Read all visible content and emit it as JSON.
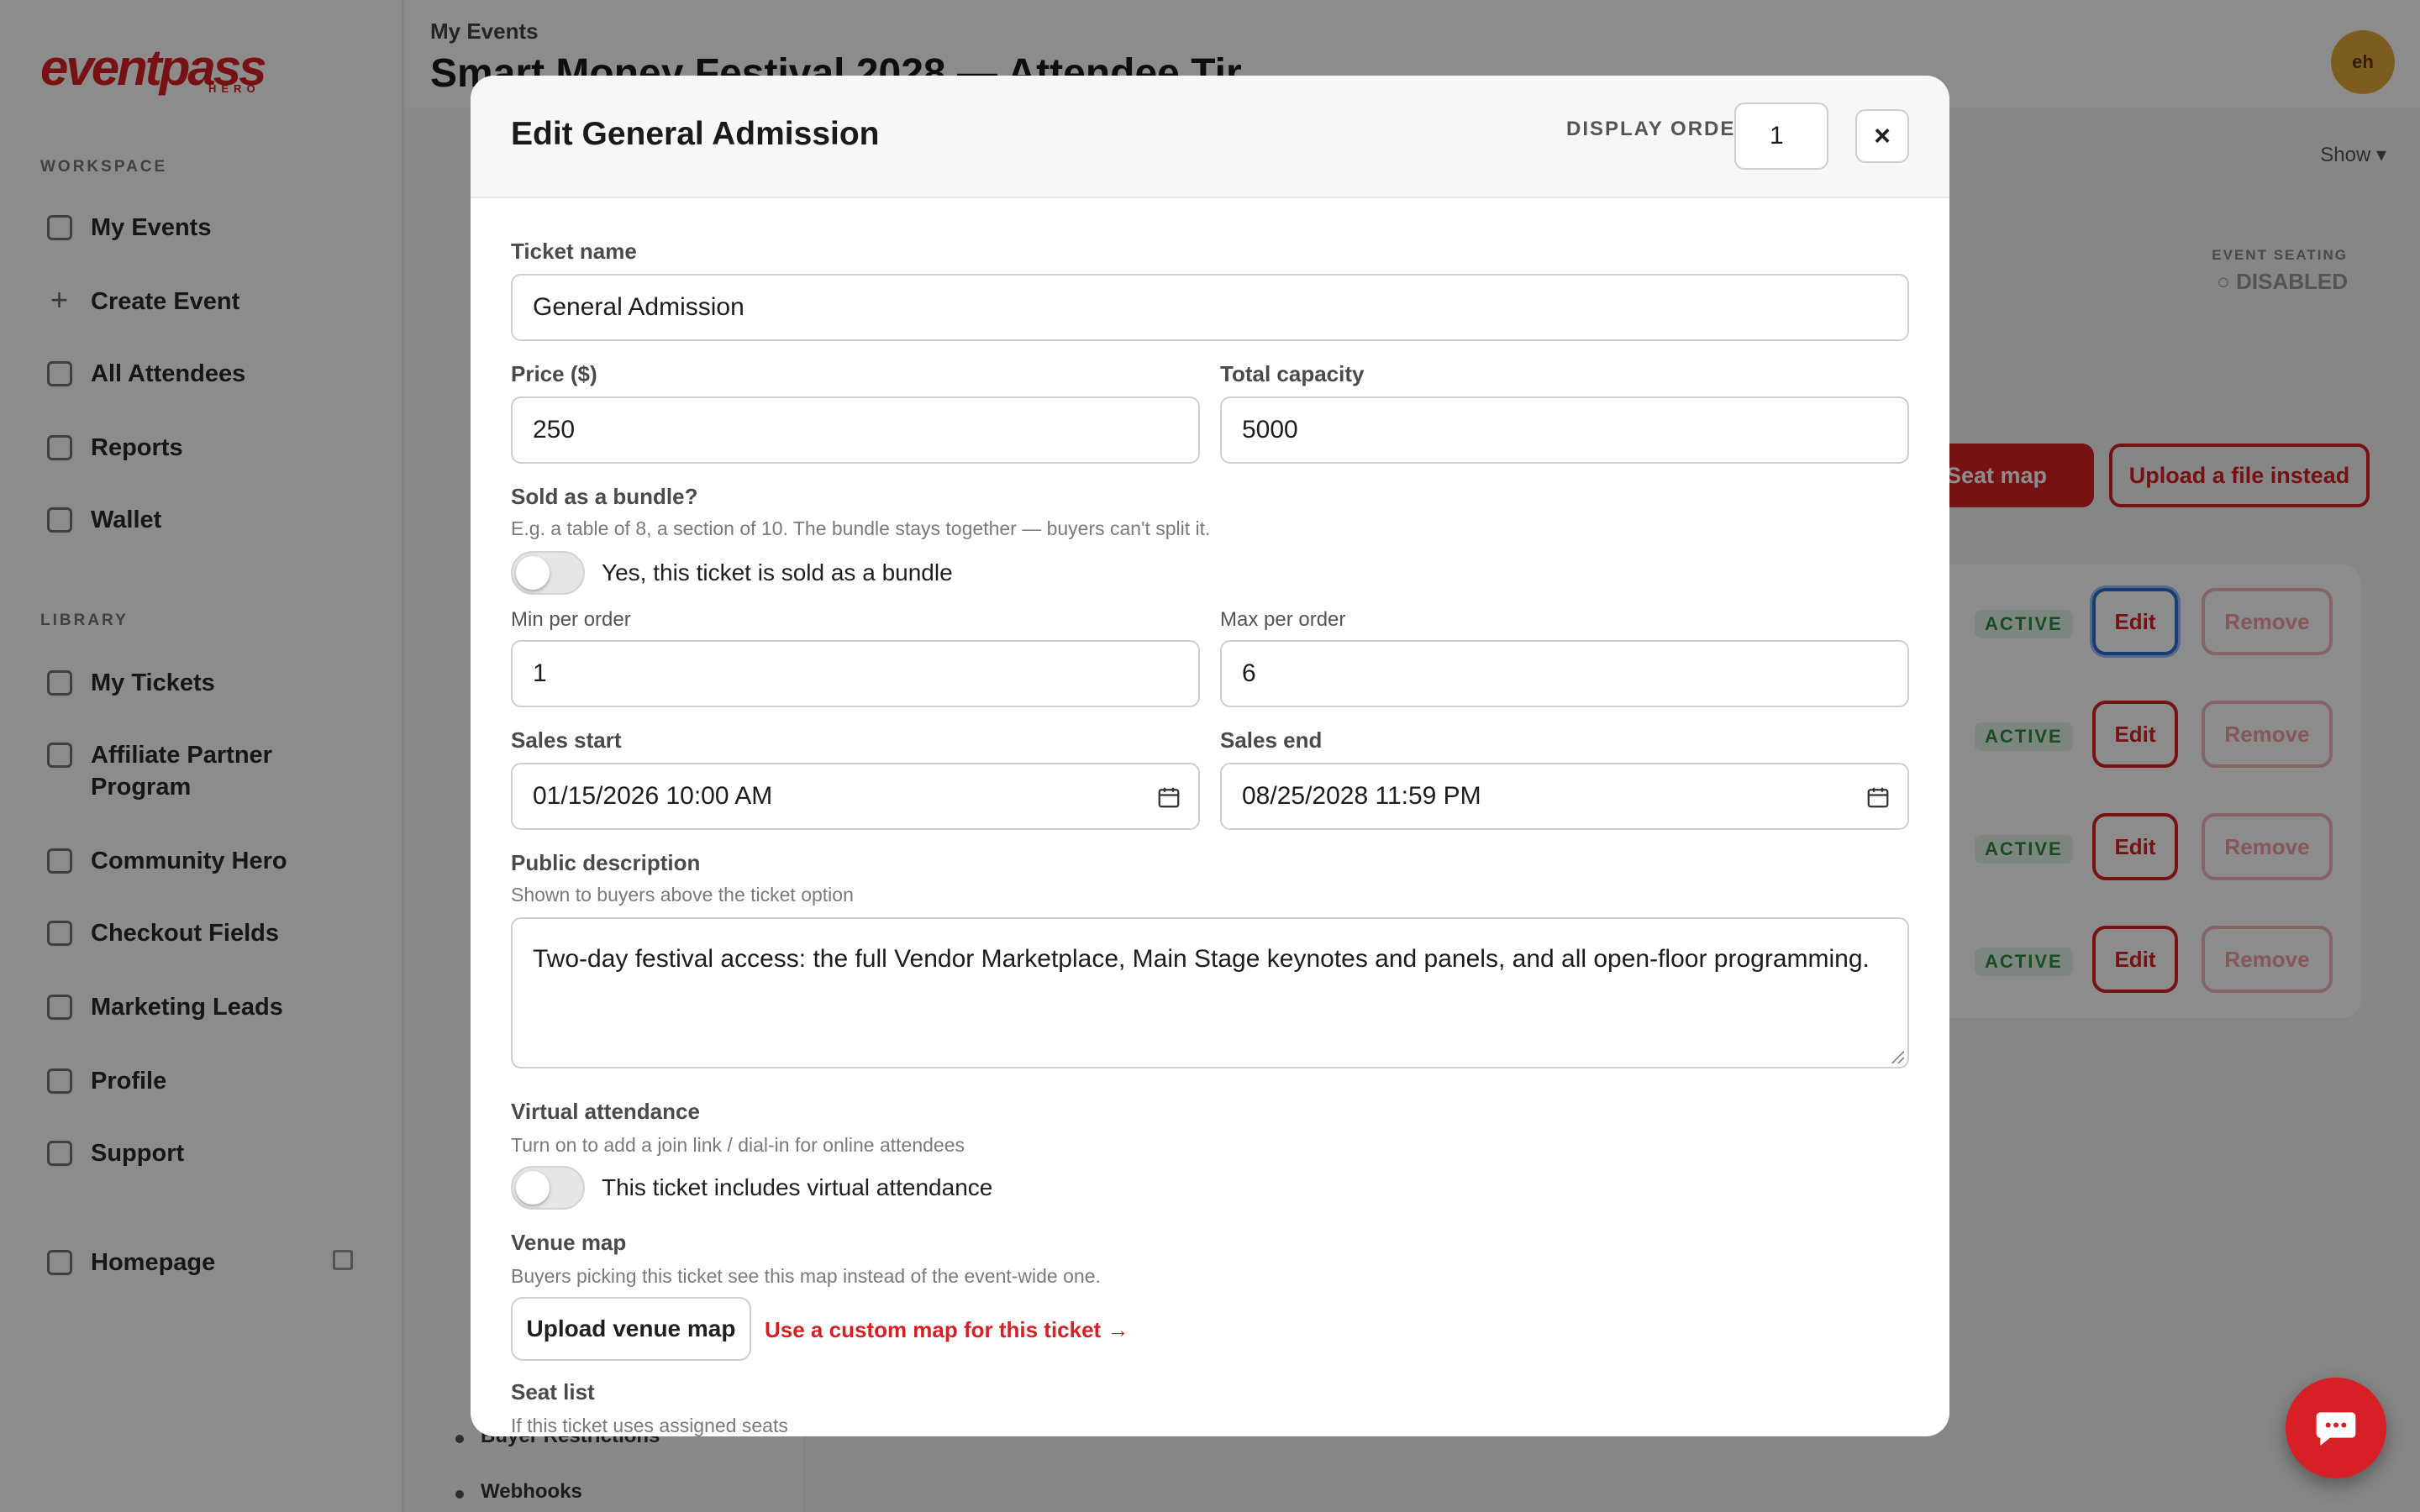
{
  "app": {
    "logo_text": "eventpass",
    "logo_sub": "HERO",
    "user_initials": "eh"
  },
  "sidebar": {
    "workspace_label": "WORKSPACE",
    "workspace_items": [
      {
        "label": "My Events",
        "icon": "grid-icon"
      },
      {
        "label": "Create Event",
        "icon": "plus-icon"
      },
      {
        "label": "All Attendees",
        "icon": "users-icon"
      },
      {
        "label": "Reports",
        "icon": "chart-icon"
      },
      {
        "label": "Wallet",
        "icon": "wallet-icon"
      }
    ],
    "library_label": "LIBRARY",
    "library_items": [
      {
        "label": "My Tickets",
        "icon": "ticket-icon"
      },
      {
        "label": "Affiliate Partner Program",
        "icon": "trophy-icon"
      },
      {
        "label": "Community Hero",
        "icon": "megaphone-icon"
      },
      {
        "label": "Checkout Fields",
        "icon": "clipboard-icon"
      },
      {
        "label": "Marketing Leads",
        "icon": "mail-icon"
      },
      {
        "label": "Profile",
        "icon": "person-icon"
      },
      {
        "label": "Support",
        "icon": "support-icon"
      }
    ],
    "homepage_label": "Homepage"
  },
  "header": {
    "breadcrumb": "My Events",
    "title": "Smart Money Festival 2028 — Attendee Tir"
  },
  "background": {
    "show_label": "Show",
    "subnav_items": [
      "Buyer Restrictions",
      "Webhooks"
    ],
    "seating_label": "EVENT SEATING",
    "seating_value": "○ DISABLED",
    "seat_map_button": "Seat map",
    "upload_file_button": "Upload a file instead",
    "tier_status": "ACTIVE",
    "edit_label": "Edit",
    "remove_label": "Remove"
  },
  "modal": {
    "title": "Edit General Admission",
    "display_order_label": "DISPLAY ORDER",
    "display_order_value": "1",
    "close_label": "×",
    "ticket_name_label": "Ticket name",
    "ticket_name_value": "General Admission",
    "price_label": "Price ($)",
    "price_value": "250",
    "capacity_label": "Total capacity",
    "capacity_value": "5000",
    "bundle_label": "Sold as a bundle?",
    "bundle_help": "E.g. a table of 8, a section of 10. The bundle stays together — buyers can't split it.",
    "bundle_toggle_text": "Yes, this ticket is sold as a bundle",
    "bundle_on": false,
    "min_label": "Min per order",
    "min_value": "1",
    "max_label": "Max per order",
    "max_value": "6",
    "sales_start_label": "Sales start",
    "sales_start_value": "01/15/2026 10:00 AM",
    "sales_end_label": "Sales end",
    "sales_end_value": "08/25/2028 11:59 PM",
    "description_label": "Public description",
    "description_help": "Shown to buyers above the ticket option",
    "description_value": "Two-day festival access: the full Vendor Marketplace, Main Stage keynotes and panels, and all open-floor programming.",
    "virtual_label": "Virtual attendance",
    "virtual_help": "Turn on to add a join link / dial-in for online attendees",
    "virtual_toggle_text": "This ticket includes virtual attendance",
    "virtual_on": false,
    "venue_label": "Venue map",
    "venue_help": "Buyers picking this ticket see this map instead of the event-wide one.",
    "upload_venue_label": "Upload venue map",
    "custom_map_link": "Use a custom map for this ticket →",
    "seat_list_label": "Seat list",
    "seat_list_help": "If this ticket uses assigned seats"
  },
  "colors": {
    "brand_red": "#d71f26",
    "overlay": "rgba(0,0,0,0.45)"
  }
}
